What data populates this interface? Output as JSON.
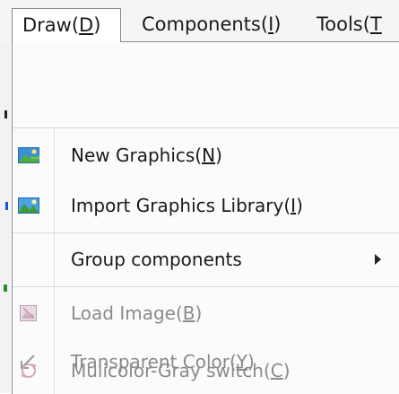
{
  "menubar": {
    "items": [
      {
        "label": "Draw(",
        "accel": "D",
        "suffix": ")"
      },
      {
        "label": "Components(",
        "accel": "I",
        "suffix": ")"
      },
      {
        "label": "Tools(",
        "accel": "T",
        "suffix": ""
      }
    ]
  },
  "dropdown": {
    "items": [
      {
        "label": "New Graphics(",
        "accel": "N",
        "suffix": ")",
        "icon": "new-graphics-icon"
      },
      {
        "label": "Import Graphics Library(",
        "accel": "I",
        "suffix": ")",
        "icon": "import-graphics-icon"
      },
      {
        "label": "Group components",
        "icon": "none",
        "submenu": true
      },
      {
        "label": "Load Image(",
        "accel": "B",
        "suffix": ")",
        "icon": "load-image-icon",
        "disabled": true
      },
      {
        "label": "Transparent Color(",
        "accel": "Y",
        "suffix": ")",
        "icon": "transparent-color-icon",
        "disabled": true
      },
      {
        "label": "Mulicolor-Gray switch(",
        "accel": "C",
        "suffix": ")",
        "icon": "multicolor-gray-switch-icon",
        "disabled": true
      }
    ]
  }
}
